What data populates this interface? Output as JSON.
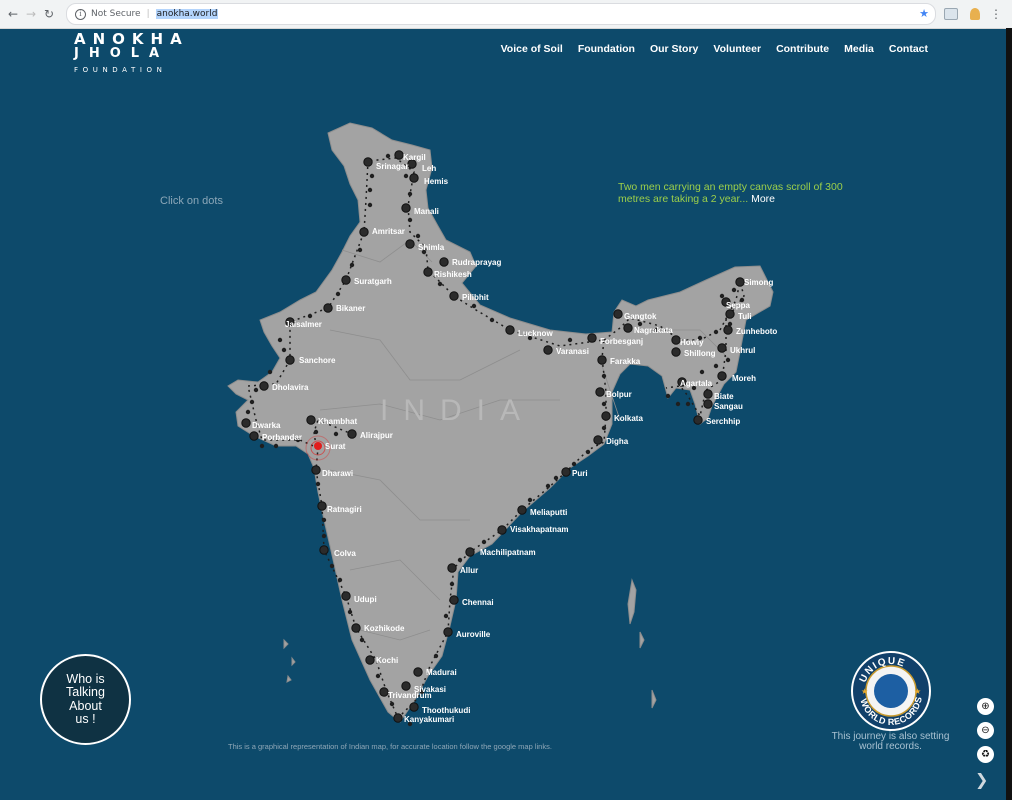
{
  "browser": {
    "security_text": "Not Secure",
    "url": "anokha.world"
  },
  "logo": {
    "line1": "ANOKHA",
    "line2": "JHOLA",
    "line3": "FOUNDATION"
  },
  "nav": {
    "items": [
      "Voice of Soil",
      "Foundation",
      "Our Story",
      "Volunteer",
      "Contribute",
      "Media",
      "Contact"
    ]
  },
  "hint": "Click on dots",
  "tagline": {
    "text": "Two men carrying an empty canvas scroll of 300 metres are taking a 2 year...",
    "more": "More"
  },
  "map": {
    "title": "INDIA",
    "colors": {
      "land": "#a3a3a3",
      "ocean": "#0d4a6b",
      "dot": "#2b2b2b",
      "route": "#1f1f1f",
      "current": "#e21c1c"
    },
    "current_city": "Surat",
    "cities": [
      "Kargil",
      "Srinagar",
      "Leh",
      "Hemis",
      "Manali",
      "Amritsar",
      "Shimla",
      "Rudraprayag",
      "Rishikesh",
      "Suratgarh",
      "Pilibhit",
      "Bikaner",
      "Jaisalmer",
      "Lucknow",
      "Varanasi",
      "Sanchore",
      "Dholavira",
      "Khambhat",
      "Dwarka",
      "Porbandar",
      "Alirajpur",
      "Surat",
      "Dharawi",
      "Ratnagiri",
      "Colva",
      "Udupi",
      "Kozhikode",
      "Kochi",
      "Trivandrum",
      "Kanyakumari",
      "Thoothukudi",
      "Sivakasi",
      "Madurai",
      "Auroville",
      "Chennai",
      "Allur",
      "Machilipatnam",
      "Visakhapatnam",
      "Meliaputti",
      "Puri",
      "Digha",
      "Kolkata",
      "Bolpur",
      "Farakka",
      "Forbesganj",
      "Gangtok",
      "Nagrakata",
      "Howly",
      "Shillong",
      "Agartala",
      "Biate",
      "Sangau",
      "Serchhip",
      "Moreh",
      "Ukhrul",
      "Zunheboto",
      "Tuli",
      "Seppa",
      "Simong"
    ]
  },
  "talk_button": {
    "line1": "Who is",
    "line2": "Talking",
    "line3": "About",
    "line4": "us !"
  },
  "disclaimer": "This is a graphical representation of Indian map, for accurate location follow the google map links.",
  "record": {
    "badge_top": "UNIQUE",
    "badge_bottom": "WORLD RECORDS",
    "text_line1": "This journey is also setting",
    "text_line2": "world records."
  },
  "controls": {
    "zoom_in_icon": "zoom-in-icon",
    "zoom_out_icon": "zoom-out-icon",
    "reset_icon": "recycle-icon",
    "down_icon": "chevron-down-icon"
  }
}
